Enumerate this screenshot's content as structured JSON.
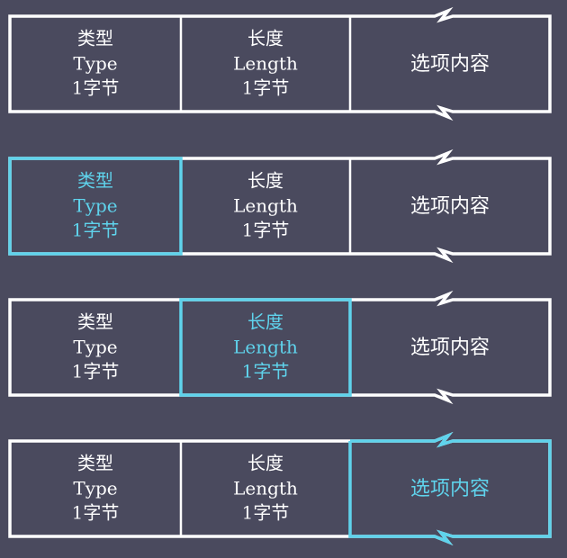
{
  "colors": {
    "background": "#4a4a5e",
    "stroke": "#ffffff",
    "highlight": "#5fd3ec",
    "text": "#ffffff"
  },
  "fields": {
    "type": [
      "类型",
      "Type",
      "1字节"
    ],
    "length": [
      "长度",
      "Length",
      "1字节"
    ],
    "content": "选项内容"
  },
  "rows": [
    {
      "highlight": "none"
    },
    {
      "highlight": "type"
    },
    {
      "highlight": "length"
    },
    {
      "highlight": "content"
    }
  ]
}
